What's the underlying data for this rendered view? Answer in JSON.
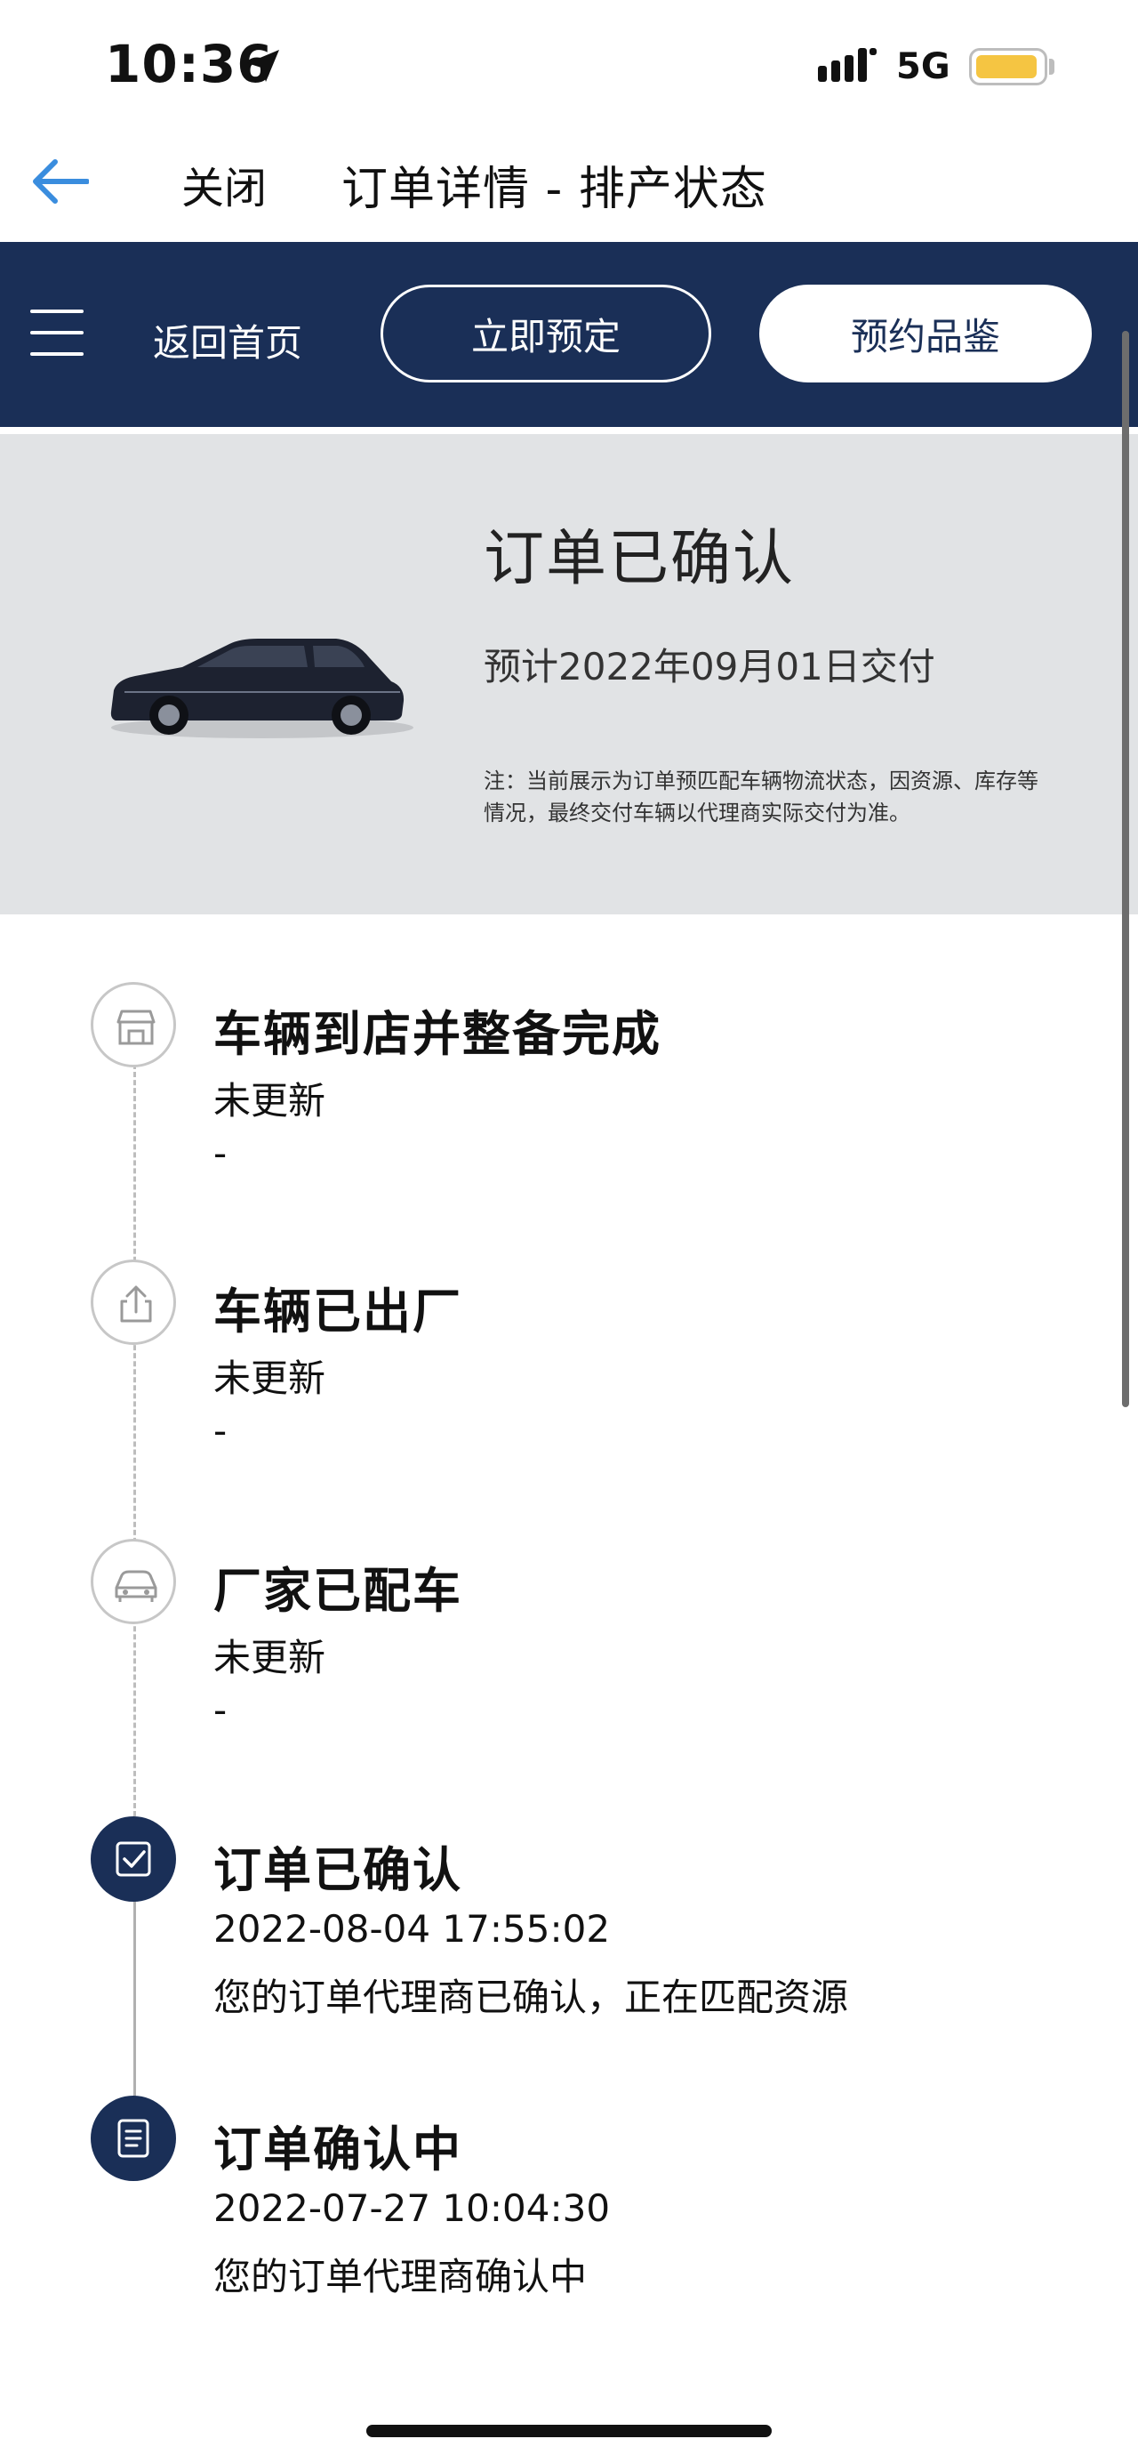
{
  "status_bar": {
    "time": "10:36",
    "network": "5G"
  },
  "browser": {
    "close_label": "关闭",
    "page_title": "订单详情 - 排产状态"
  },
  "nav": {
    "home_label": "返回首页",
    "book_label": "立即预定",
    "trial_label": "预约品鉴"
  },
  "hero": {
    "title": "订单已确认",
    "delivery": "预计2022年09月01日交付",
    "note": "注：当前展示为订单预匹配车辆物流状态，因资源、库存等情况，最终交付车辆以代理商实际交付为准。"
  },
  "timeline": [
    {
      "icon": "store-icon",
      "state": "pending",
      "title": "车辆到店并整备完成",
      "line1": "未更新",
      "line2": "-"
    },
    {
      "icon": "upload-icon",
      "state": "pending",
      "title": "车辆已出厂",
      "line1": "未更新",
      "line2": "-"
    },
    {
      "icon": "car-icon",
      "state": "pending",
      "title": "厂家已配车",
      "line1": "未更新",
      "line2": "-"
    },
    {
      "icon": "check-icon",
      "state": "done",
      "title": "订单已确认",
      "line1": "2022-08-04 17:55:02",
      "line2": "您的订单代理商已确认，正在匹配资源"
    },
    {
      "icon": "document-icon",
      "state": "done",
      "title": "订单确认中",
      "line1": "2022-07-27 10:04:30",
      "line2": "您的订单代理商确认中"
    }
  ],
  "colors": {
    "navy": "#1a2f57",
    "hero_bg": "#e1e3e5",
    "accent_blue": "#3a8dde",
    "battery": "#f5c542"
  }
}
